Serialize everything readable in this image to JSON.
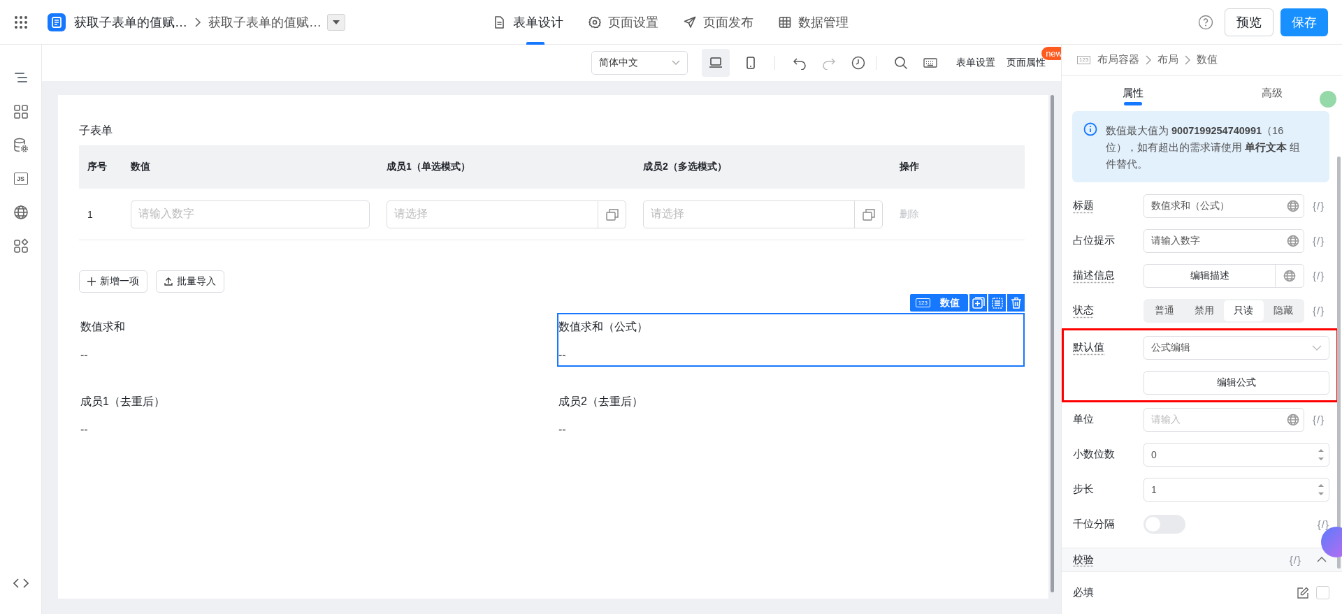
{
  "header": {
    "app_title": "获取子表单的值赋…",
    "page_title": "获取子表单的值赋…",
    "nav": [
      {
        "label": "表单设计",
        "selected": true
      },
      {
        "label": "页面设置",
        "selected": false
      },
      {
        "label": "页面发布",
        "selected": false
      },
      {
        "label": "数据管理",
        "selected": false
      }
    ],
    "preview": "预览",
    "save": "保存"
  },
  "sidebar": {
    "js_label": "JS"
  },
  "toolbar": {
    "language": "简体中文",
    "devices": [
      {
        "selected": true
      },
      {
        "selected": false
      }
    ],
    "form_settings": "表单设置",
    "page_properties": "页面属性",
    "new_badge": "new"
  },
  "canvas": {
    "subform": {
      "title": "子表单",
      "columns": [
        "序号",
        "数值",
        "成员1（单选模式）",
        "成员2（多选模式）",
        "操作"
      ],
      "rows": [
        {
          "index": "1",
          "number": {
            "placeholder": "请输入数字"
          },
          "member1": {
            "placeholder": "请选择"
          },
          "member2": {
            "placeholder": "请选择"
          },
          "action": "删除"
        }
      ],
      "add_button": "新增一项",
      "import_button": "批量导入"
    },
    "fields": [
      {
        "label": "数值求和",
        "value": "--",
        "selected": false
      },
      {
        "label": "数值求和（公式）",
        "value": "--",
        "selected": true
      },
      {
        "label": "成员1（去重后）",
        "value": "--",
        "selected": false
      },
      {
        "label": "成员2（去重后）",
        "value": "--",
        "selected": false
      }
    ],
    "selection_toolbar": {
      "type_badge": "123",
      "type_label": "数值"
    }
  },
  "panel": {
    "breadcrumb": {
      "badge": "123",
      "items": [
        "布局容器",
        "布局",
        "数值"
      ]
    },
    "tabs": [
      {
        "label": "属性",
        "selected": true
      },
      {
        "label": "高级",
        "selected": false
      }
    ],
    "notice": "数值最大值为 **9007199254740991**（16位），如有超出的需求请使用 **单行文本** 组件替代。",
    "props": [
      {
        "kind": "text",
        "label": "标题",
        "tip": true,
        "value": "数值求和（公式）",
        "expression": "{/}"
      },
      {
        "kind": "text",
        "label": "占位提示",
        "tip": false,
        "value": "请输入数字",
        "expression": "{/}"
      },
      {
        "kind": "button",
        "label": "描述信息",
        "tip": true,
        "button": "编辑描述",
        "expression": "{/}"
      },
      {
        "kind": "segmented",
        "label": "状态",
        "tip": true,
        "options": [
          {
            "label": "普通",
            "selected": false
          },
          {
            "label": "禁用",
            "selected": false
          },
          {
            "label": "只读",
            "selected": true
          },
          {
            "label": "隐藏",
            "selected": false
          }
        ],
        "expression": "{/}"
      },
      {
        "kind": "formula",
        "label": "默认值",
        "tip": true,
        "value": "公式编辑",
        "button": "编辑公式",
        "highlighted": true
      },
      {
        "kind": "text",
        "label": "单位",
        "tip": false,
        "placeholder": "请输入",
        "expression": "{/}"
      },
      {
        "kind": "number",
        "label": "小数位数",
        "tip": false,
        "value": "0"
      },
      {
        "kind": "number",
        "label": "步长",
        "tip": false,
        "value": "1"
      },
      {
        "kind": "switch",
        "label": "千位分隔",
        "tip": false,
        "on": false,
        "expression": "{/}"
      }
    ],
    "validation": {
      "title": "校验",
      "tip": true,
      "expression": "{/}",
      "expanded": true,
      "items": [
        {
          "label": "必填",
          "tip": false,
          "checked": false
        }
      ]
    }
  }
}
